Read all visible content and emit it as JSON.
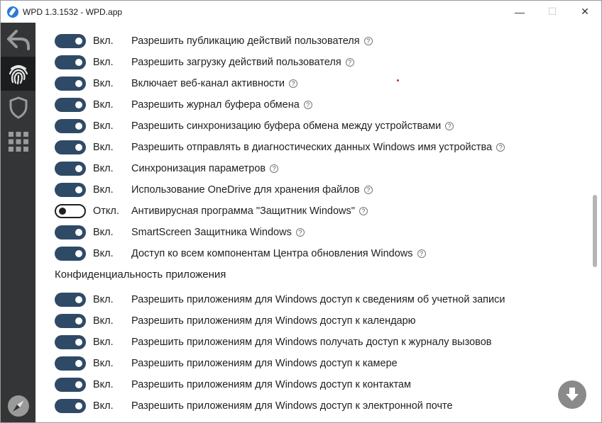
{
  "window": {
    "title": "WPD 1.3.1532 - WPD.app",
    "minimize_glyph": "—",
    "maximize_glyph": "☐",
    "close_glyph": "✕"
  },
  "sidebar": {
    "items": [
      {
        "icon": "back-arrow-icon",
        "active": false
      },
      {
        "icon": "fingerprint-icon",
        "active": true
      },
      {
        "icon": "shield-icon",
        "active": false
      },
      {
        "icon": "apps-grid-icon",
        "active": false
      },
      {
        "icon": "compass-icon",
        "active": false
      }
    ]
  },
  "help_glyph": "?",
  "rows_top": [
    {
      "state": "Вкл.",
      "on": true,
      "label": "Разрешить публикацию действий пользователя",
      "help": true
    },
    {
      "state": "Вкл.",
      "on": true,
      "label": "Разрешить загрузку действий пользователя",
      "help": true
    },
    {
      "state": "Вкл.",
      "on": true,
      "label": "Включает веб-канал активности",
      "help": true
    },
    {
      "state": "Вкл.",
      "on": true,
      "label": "Разрешить журнал буфера обмена",
      "help": true
    },
    {
      "state": "Вкл.",
      "on": true,
      "label": "Разрешить синхронизацию буфера обмена между устройствами",
      "help": true
    },
    {
      "state": "Вкл.",
      "on": true,
      "label": "Разрешить отправлять в диагностических данных Windows имя устройства",
      "help": true
    },
    {
      "state": "Вкл.",
      "on": true,
      "label": "Синхронизация параметров",
      "help": true
    },
    {
      "state": "Вкл.",
      "on": true,
      "label": "Использование OneDrive для хранения файлов",
      "help": true
    },
    {
      "state": "Откл.",
      "on": false,
      "label": "Антивирусная программа \"Защитник Windows\"",
      "help": true
    },
    {
      "state": "Вкл.",
      "on": true,
      "label": "SmartScreen Защитника Windows",
      "help": true
    },
    {
      "state": "Вкл.",
      "on": true,
      "label": "Доступ ко всем компонентам Центра обновления Windows",
      "help": true
    }
  ],
  "section": {
    "title": "Конфиденциальность приложения"
  },
  "rows_app": [
    {
      "state": "Вкл.",
      "on": true,
      "label": "Разрешить приложениям для Windows доступ к сведениям об учетной записи"
    },
    {
      "state": "Вкл.",
      "on": true,
      "label": "Разрешить приложениям для Windows доступ к календарю"
    },
    {
      "state": "Вкл.",
      "on": true,
      "label": "Разрешить приложениям для Windows получать доступ к журналу вызовов"
    },
    {
      "state": "Вкл.",
      "on": true,
      "label": "Разрешить приложениям для Windows доступ к камере"
    },
    {
      "state": "Вкл.",
      "on": true,
      "label": "Разрешить приложениям для Windows доступ к контактам"
    },
    {
      "state": "Вкл.",
      "on": true,
      "label": "Разрешить приложениям для Windows доступ к электронной почте"
    }
  ],
  "colors": {
    "sidebar_bg": "#333537",
    "sidebar_active": "#1c1d1e",
    "toggle_on": "#2e4a66",
    "scroll_button": "#8a8a8a"
  }
}
